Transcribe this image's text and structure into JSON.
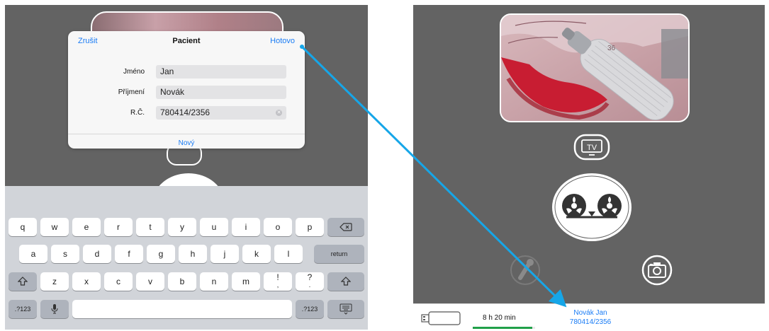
{
  "colors": {
    "accent": "#1a7cf5",
    "arrow": "#16a6e8",
    "progress": "#21a049"
  },
  "dialog": {
    "cancel_label": "Zrušit",
    "title": "Pacient",
    "done_label": "Hotovo",
    "fields": [
      {
        "label": "Jméno",
        "value": "Jan"
      },
      {
        "label": "Příjmení",
        "value": "Novák"
      },
      {
        "label": "R.Č.",
        "value": "780414/2356"
      }
    ],
    "new_label": "Nový"
  },
  "keyboard": {
    "row1": [
      "q",
      "w",
      "e",
      "r",
      "t",
      "y",
      "u",
      "i",
      "o",
      "p"
    ],
    "row2": [
      "a",
      "s",
      "d",
      "f",
      "g",
      "h",
      "j",
      "k",
      "l"
    ],
    "row3": [
      "z",
      "x",
      "c",
      "v",
      "b",
      "n",
      "m",
      "!",
      "?"
    ],
    "row3_sub": [
      ",",
      "."
    ],
    "return_label": "return",
    "numbers_label": ".?123",
    "icons": {
      "backspace": "backspace-icon",
      "shift": "shift-icon",
      "mic": "mic-icon",
      "hide": "keyboard-hide-icon"
    }
  },
  "controls": {
    "tv_label": "TV",
    "icons": [
      "video-preview",
      "tv-icon",
      "record-icon",
      "camera-icon",
      "mic-icon"
    ]
  },
  "status": {
    "time_remaining": "8 h 20 min",
    "storage_fill": 0.95,
    "patient_name": "Novák Jan",
    "patient_id": "780414/2356",
    "icons": [
      "usb-drive-icon"
    ]
  }
}
